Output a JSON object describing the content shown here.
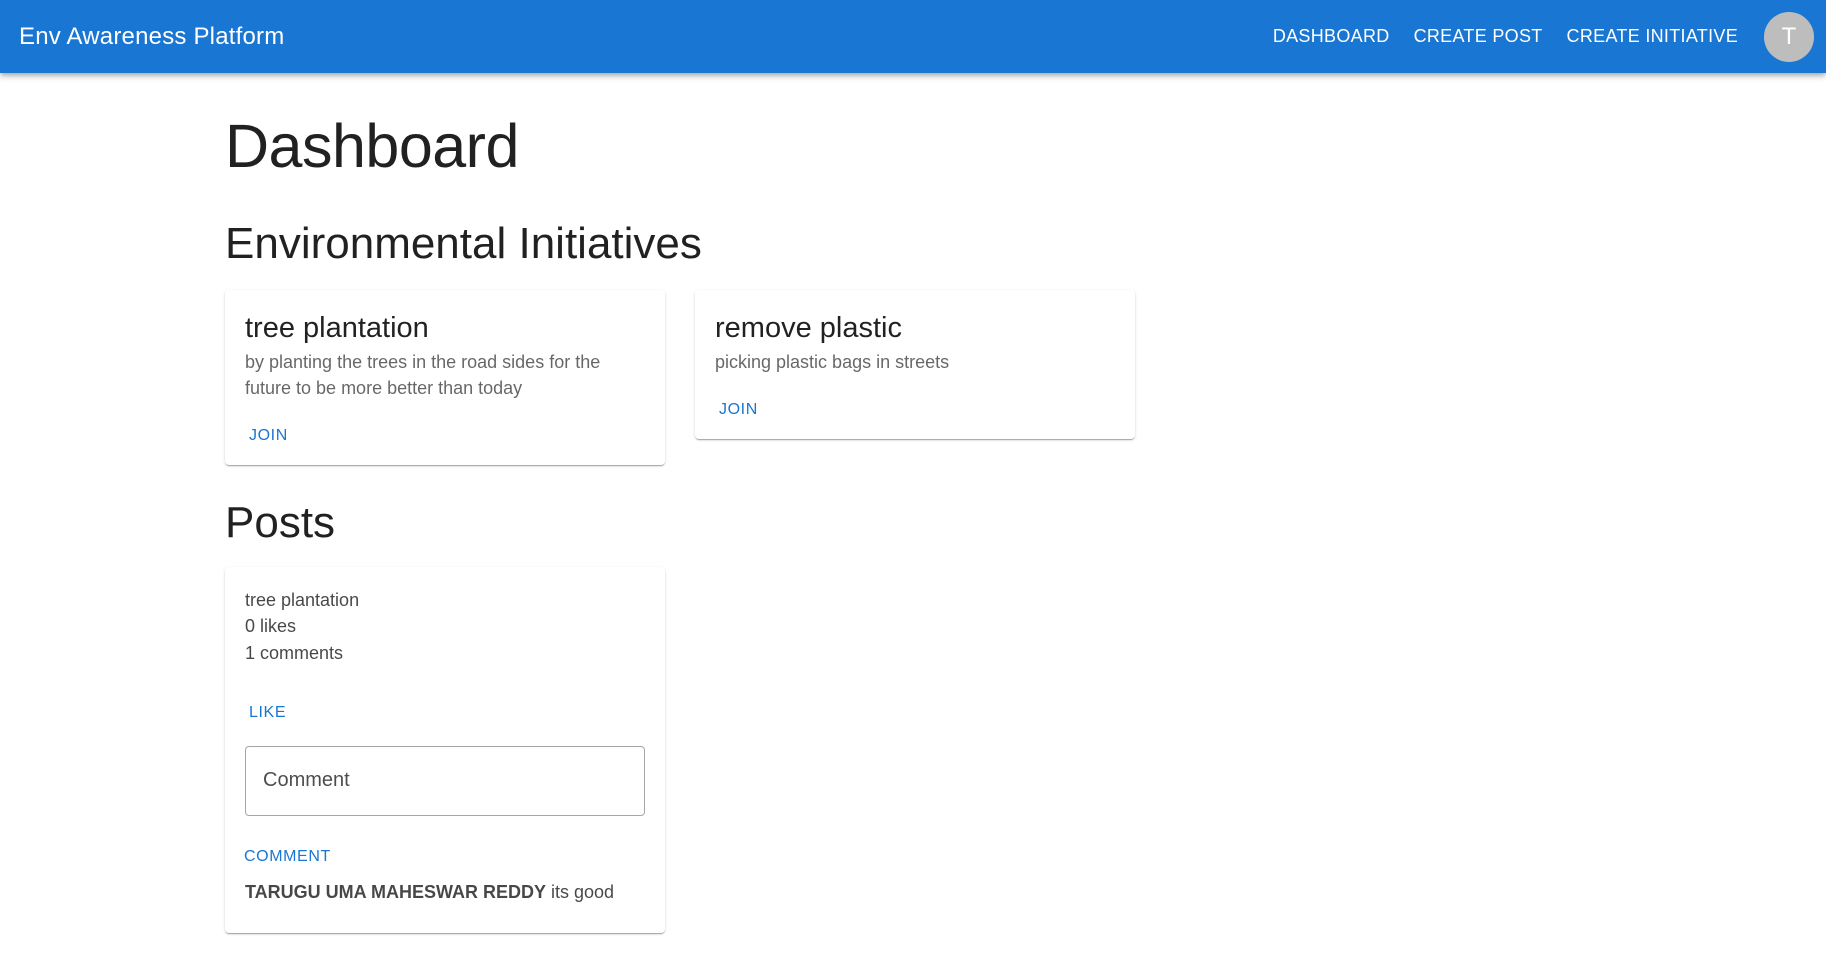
{
  "appbar": {
    "title": "Env Awareness Platform",
    "nav": [
      "DASHBOARD",
      "CREATE POST",
      "CREATE INITIATIVE"
    ],
    "avatar_letter": "T"
  },
  "page": {
    "title": "Dashboard"
  },
  "initiatives": {
    "heading": "Environmental Initiatives",
    "items": [
      {
        "title": "tree plantation",
        "description": "by planting the trees in the road sides for the future to be more better than today",
        "action": "JOIN"
      },
      {
        "title": "remove plastic",
        "description": "picking plastic bags in streets",
        "action": "JOIN"
      }
    ]
  },
  "posts": {
    "heading": "Posts",
    "items": [
      {
        "text": "tree plantation",
        "likes": "0 likes",
        "comments_count": "1 comments",
        "like_label": "LIKE",
        "comment_placeholder": "Comment",
        "comment_button": "COMMENT",
        "comments": [
          {
            "author": "TARUGU UMA MAHESWAR REDDY",
            "text": "its good"
          }
        ]
      }
    ]
  },
  "colors": {
    "primary": "#1976d2",
    "avatar_bg": "#bdbdbd"
  }
}
